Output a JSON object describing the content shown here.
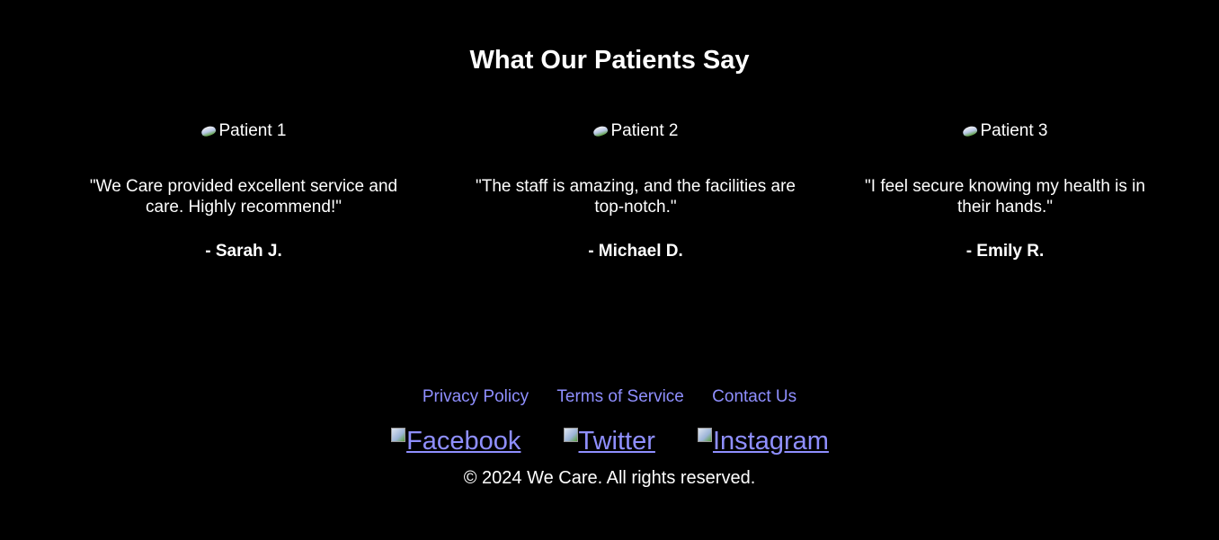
{
  "testimonials_section": {
    "title": "What Our Patients Say",
    "items": [
      {
        "image_alt": "Patient 1",
        "quote": "\"We Care provided excellent service and care. Highly recommend!\"",
        "author": "- Sarah J."
      },
      {
        "image_alt": "Patient 2",
        "quote": "\"The staff is amazing, and the facilities are top-notch.\"",
        "author": "- Michael D."
      },
      {
        "image_alt": "Patient 3",
        "quote": "\"I feel secure knowing my health is in their hands.\"",
        "author": "- Emily R."
      }
    ]
  },
  "footer": {
    "links": [
      "Privacy Policy",
      "Terms of Service",
      "Contact Us"
    ],
    "social": [
      "Facebook",
      "Twitter",
      "Instagram"
    ],
    "copyright": "© 2024 We Care. All rights reserved."
  },
  "colors": {
    "background": "#000000",
    "text": "#ffffff",
    "link": "#8f8fff"
  },
  "icons": {
    "broken_image": "broken-image-icon"
  }
}
